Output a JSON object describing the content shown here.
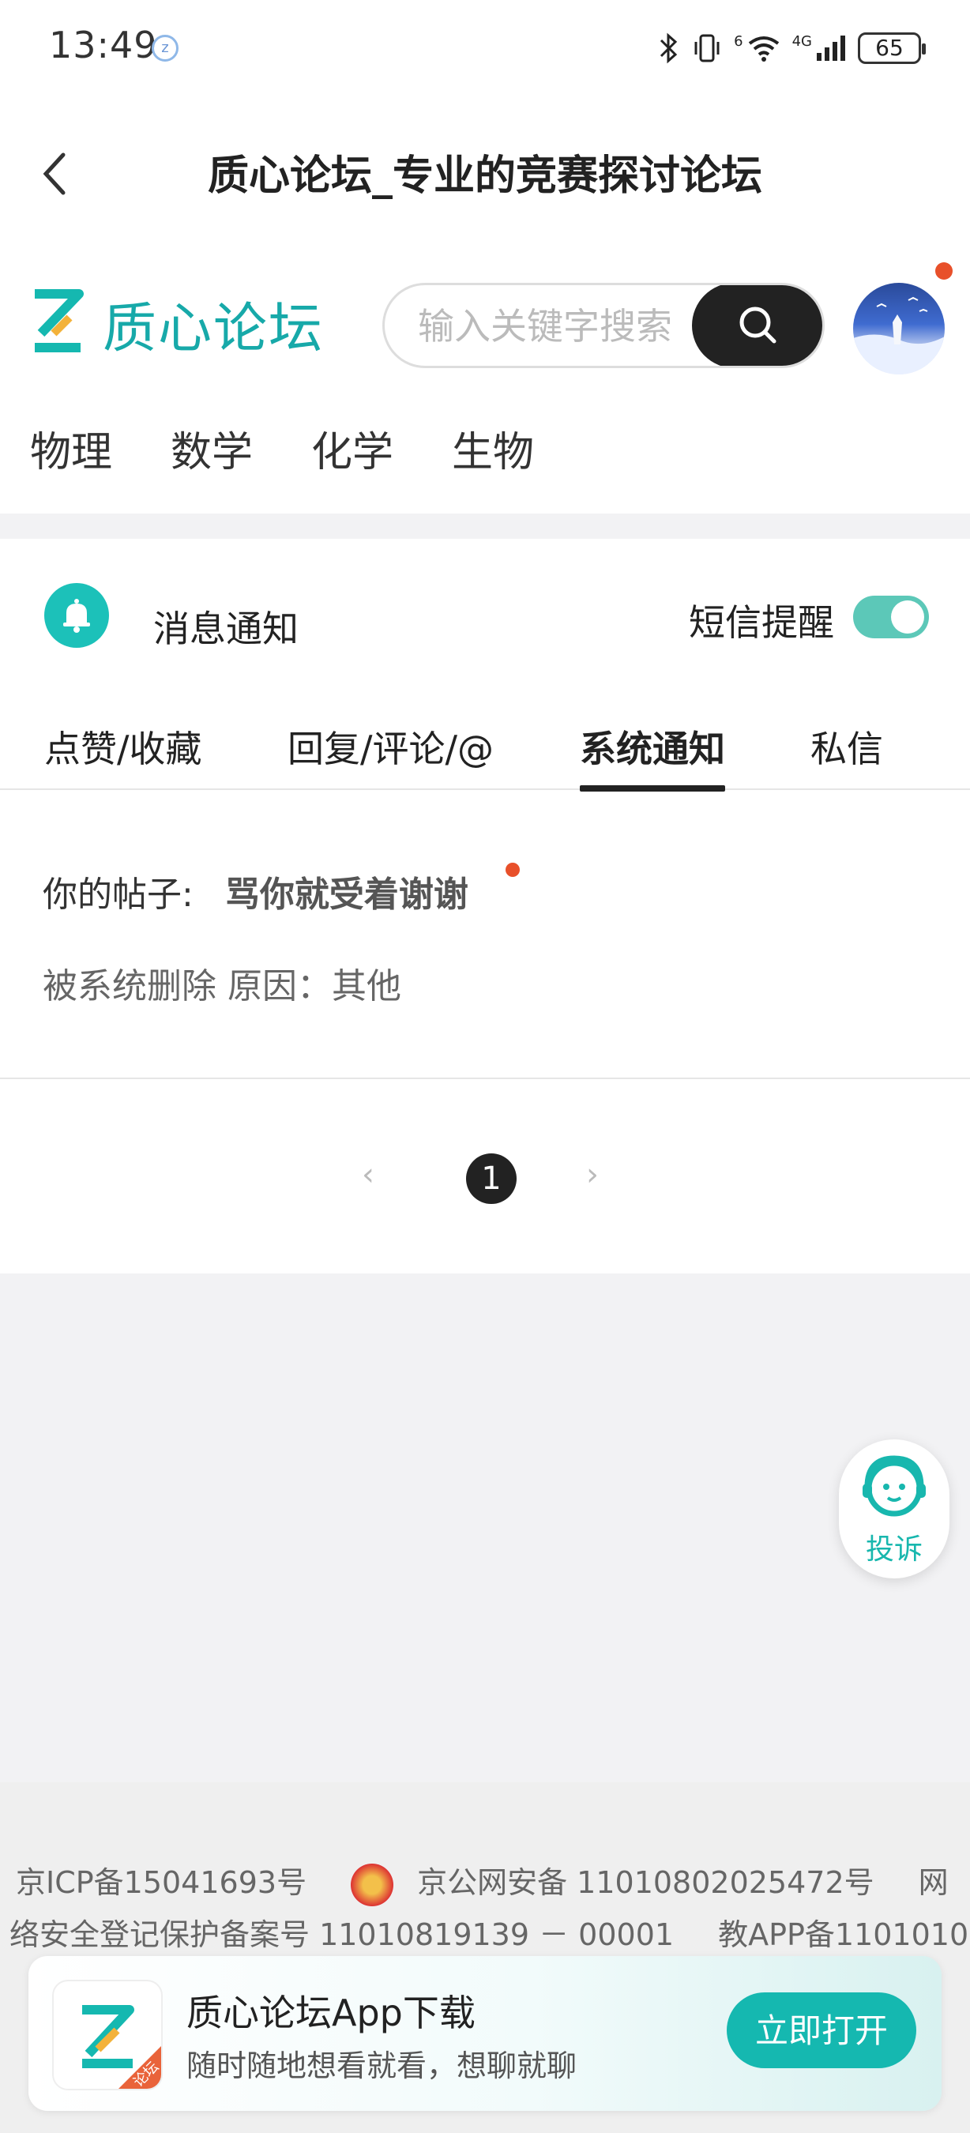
{
  "status_bar": {
    "time": "13:49",
    "battery": "65",
    "network": "4G",
    "sim_small": "6",
    "icons": [
      "bluetooth-icon",
      "vibrate-icon",
      "wifi-icon",
      "signal-icon",
      "battery-icon"
    ]
  },
  "titlebar": {
    "title": "质心论坛_专业的竞赛探讨论坛"
  },
  "header": {
    "logo_text": "质心论坛",
    "search_placeholder": "输入关键字搜索",
    "nav": [
      "物理",
      "数学",
      "化学",
      "生物"
    ]
  },
  "messages": {
    "title": "消息通知",
    "sms_label": "短信提醒",
    "sms_enabled": true,
    "tabs": [
      "点赞/收藏",
      "回复/评论/@",
      "系统通知",
      "私信"
    ],
    "active_tab": "系统通知",
    "notice": {
      "prefix": "你的帖子:",
      "post_title": "骂你就受着谢谢",
      "detail": "被系统删除 原因：其他"
    },
    "pagination": {
      "current": "1"
    }
  },
  "complaint": {
    "label": "投诉"
  },
  "footer": {
    "line1_a": "京ICP备15041693号",
    "line1_b": "京公网安备 11010802025472号",
    "line1_c": "网",
    "line2": "络安全登记保护备案号 11010819139 － 00001",
    "line2_b": "教APP备1101010"
  },
  "app_banner": {
    "icon_badge": "论坛",
    "title": "质心论坛App下载",
    "subtitle": "随时随地想看就看，想聊就聊",
    "button": "立即打开"
  },
  "colors": {
    "brand": "#17a9a9",
    "accent": "#15b8b0",
    "badge": "#e8502a",
    "dark": "#222222"
  }
}
